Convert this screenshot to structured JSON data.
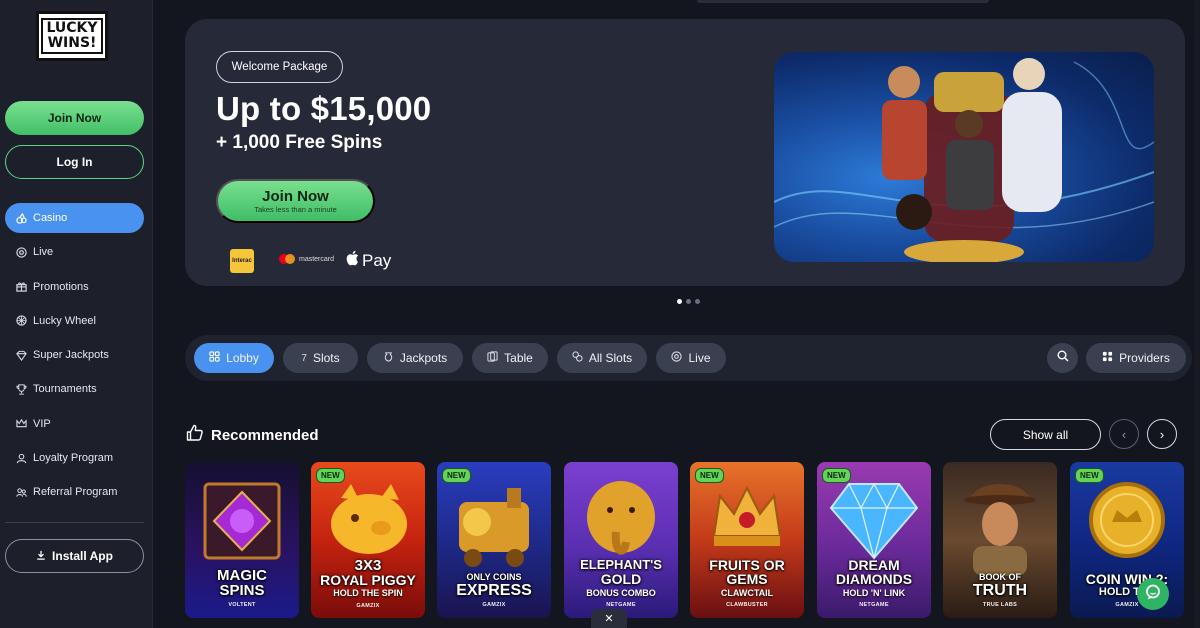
{
  "brand": {
    "logo_line1": "LUCKY",
    "logo_line2": "WINS!"
  },
  "sidebar": {
    "join_label": "Join Now",
    "login_label": "Log In",
    "items": [
      {
        "label": "Casino",
        "icon": "casino-icon",
        "active": true
      },
      {
        "label": "Live",
        "icon": "live-icon"
      },
      {
        "label": "Promotions",
        "icon": "gift-icon"
      },
      {
        "label": "Lucky Wheel",
        "icon": "wheel-icon"
      },
      {
        "label": "Super Jackpots",
        "icon": "diamond-icon"
      },
      {
        "label": "Tournaments",
        "icon": "trophy-icon"
      },
      {
        "label": "VIP",
        "icon": "crown-icon"
      },
      {
        "label": "Loyalty Program",
        "icon": "loyalty-icon"
      },
      {
        "label": "Referral Program",
        "icon": "referral-icon"
      }
    ],
    "install_label": "Install App"
  },
  "banner": {
    "pill": "Welcome Package",
    "title": "Up to $15,000",
    "subtitle": "+ 1,000 Free Spins",
    "cta_label": "Join Now",
    "cta_sublabel": "Takes less than a minute",
    "payments": {
      "interac": "Interac",
      "mastercard": "mastercard",
      "applepay": "Pay"
    },
    "slide_count": 3,
    "active_slide": 1
  },
  "categories": {
    "items": [
      {
        "label": "Lobby",
        "icon": "lobby-icon",
        "active": true
      },
      {
        "label": "Slots",
        "icon": "slots-icon"
      },
      {
        "label": "Jackpots",
        "icon": "jackpots-icon"
      },
      {
        "label": "Table",
        "icon": "table-icon"
      },
      {
        "label": "All Slots",
        "icon": "all-slots-icon"
      },
      {
        "label": "Live",
        "icon": "live-icon"
      }
    ],
    "providers_label": "Providers"
  },
  "recommended": {
    "title": "Recommended",
    "show_all": "Show all",
    "new_badge": "NEW",
    "games": [
      {
        "name1": "MAGIC",
        "name2": "SPINS",
        "sub": "",
        "provider": "VOLTENT",
        "new": false
      },
      {
        "name1": "3X3",
        "name2": "ROYAL PIGGY",
        "sub": "HOLD THE SPIN",
        "provider": "GAMZIX",
        "new": true
      },
      {
        "name1": "ONLY COINS",
        "name2": "EXPRESS",
        "sub": "",
        "provider": "GAMZIX",
        "new": true
      },
      {
        "name1": "ELEPHANT'S",
        "name2": "GOLD",
        "sub": "BONUS COMBO",
        "provider": "NETGAME",
        "new": false
      },
      {
        "name1": "FRUITS OR",
        "name2": "GEMS",
        "sub": "CLAWCTAIL",
        "provider": "CLAWBUSTER",
        "new": true
      },
      {
        "name1": "DREAM",
        "name2": "DIAMONDS",
        "sub": "HOLD 'N' LINK",
        "provider": "NETGAME",
        "new": true
      },
      {
        "name1": "BOOK OF",
        "name2": "TRUTH",
        "sub": "",
        "provider": "TRUE LABS",
        "new": false
      },
      {
        "name1": "COIN WIN 2:",
        "name2": "HOLD THE",
        "sub": "",
        "provider": "GAMZIX",
        "new": true
      }
    ]
  },
  "colors": {
    "accent_green": "#4fcb74",
    "accent_blue": "#4a92f0",
    "bg": "#14161f",
    "panel": "#262a38"
  }
}
